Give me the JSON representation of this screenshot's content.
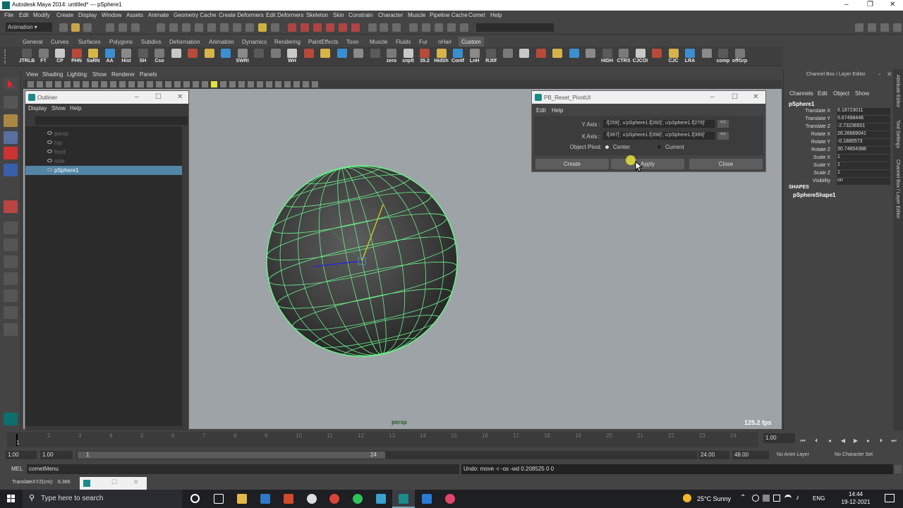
{
  "window": {
    "title": "Autodesk Maya 2014: untitled*   ---   pSphere1"
  },
  "menubar": [
    "File",
    "Edit",
    "Modify",
    "Create",
    "Display",
    "Window",
    "Assets",
    "Animate",
    "Geometry Cache",
    "Create Deformers",
    "Edit Deformers",
    "Skeleton",
    "Skin",
    "Constrain",
    "Character",
    "Muscle",
    "Pipeline Cache",
    "Comet",
    "Help"
  ],
  "statusline": {
    "mode": "Animation"
  },
  "shelf": {
    "tabs": [
      "General",
      "Curves",
      "Surfaces",
      "Polygons",
      "Subdivs",
      "Deformation",
      "Animation",
      "Dynamics",
      "Rendering",
      "PaintEffects",
      "Toon",
      "Muscle",
      "Fluids",
      "Fur",
      "nHair",
      "Custom"
    ],
    "selected_tab": "Custom",
    "items": [
      "JTRLB",
      "FT",
      "CP",
      "PHN",
      "SaRN",
      "AA",
      "Hist",
      "SH",
      "Cso",
      "",
      "",
      "",
      "",
      "SWRI",
      "",
      "",
      "WH",
      "",
      "",
      "",
      "",
      "",
      "zero",
      "snplt",
      "35.2",
      "HidSh",
      "ConIf",
      "LnH",
      "RJtIf",
      "",
      "",
      "",
      "",
      "",
      "",
      "HIDH",
      "CTRS",
      "CJCOI",
      "",
      "CJC",
      "LRA",
      "",
      "comp",
      "offGrp"
    ]
  },
  "viewport": {
    "menu": [
      "View",
      "Shading",
      "Lighting",
      "Show",
      "Renderer",
      "Panels"
    ],
    "camera_label": "persp",
    "fps": "125.2 fps"
  },
  "outliner": {
    "title": "Outliner",
    "menu": [
      "Display",
      "Show",
      "Help"
    ],
    "items": [
      {
        "name": "persp",
        "selected": false
      },
      {
        "name": "top",
        "selected": false
      },
      {
        "name": "front",
        "selected": false
      },
      {
        "name": "side",
        "selected": false
      },
      {
        "name": "pSphere1",
        "selected": true
      }
    ]
  },
  "pb_dialog": {
    "title": "PB_Reset_PivotUI",
    "menu": [
      "Edit",
      "Help"
    ],
    "y_axis_label": "Y Axis :",
    "y_axis_value": ".f[259]', u'pSphere1.f[260]', u'pSphere1.f[279]'",
    "x_axis_label": "X Axis :",
    "x_axis_value": ".f[397]', u'pSphere1.f[398]', u'pSphere1.f[399]'",
    "load_button": "<<",
    "pivot_label": "Object Pivot:",
    "pivot_options": [
      "Center",
      "Current"
    ],
    "pivot_selected": "Center",
    "buttons": [
      "Create",
      "Apply",
      "Close"
    ]
  },
  "channel_box": {
    "title": "Channel Box / Layer Editor",
    "menu": [
      "Channels",
      "Edit",
      "Object",
      "Show"
    ],
    "object": "pSphere1",
    "attributes": [
      {
        "name": "Translate X",
        "value": "6.18723011"
      },
      {
        "name": "Translate Y",
        "value": "5.67498446"
      },
      {
        "name": "Translate Z",
        "value": "-2.73236501"
      },
      {
        "name": "Rotate X",
        "value": "26.26669041"
      },
      {
        "name": "Rotate Y",
        "value": "-0.1885573"
      },
      {
        "name": "Rotate Z",
        "value": "30.74654388"
      },
      {
        "name": "Scale X",
        "value": "1"
      },
      {
        "name": "Scale Y",
        "value": "1"
      },
      {
        "name": "Scale Z",
        "value": "1"
      },
      {
        "name": "Visibility",
        "value": "on"
      }
    ],
    "shapes_label": "SHAPES",
    "shape": "pSphereShape1"
  },
  "side_tabs": [
    "Attribute Editor",
    "Tool Settings",
    "Channel Box / Layer Editor"
  ],
  "timeline": {
    "current_frame": "1.00",
    "ticks": [
      "1",
      "2",
      "3",
      "4",
      "5",
      "6",
      "7",
      "8",
      "9",
      "10",
      "11",
      "12",
      "13",
      "14",
      "15",
      "16",
      "17",
      "18",
      "19",
      "20",
      "21",
      "22",
      "23",
      "24"
    ],
    "range": {
      "start": "1.00",
      "inner_start": "1.00",
      "slider_start": "1",
      "slider_end": "24",
      "inner_end": "24.00",
      "end": "48.00"
    },
    "anim_layer": "No Anim Layer",
    "char_set": "No Character Set"
  },
  "command_line": {
    "label": "MEL",
    "input": "cometMenu",
    "result": "Undo: move -r -os -wd 0.208525 0 0"
  },
  "help_line": {
    "label": "TranslateXYZ(cm):",
    "value": "6.366"
  },
  "taskbar": {
    "search_placeholder": "Type here to search",
    "weather": "25°C  Sunny",
    "lang": "ENG",
    "time": "14:44",
    "date": "19-12-2021"
  }
}
